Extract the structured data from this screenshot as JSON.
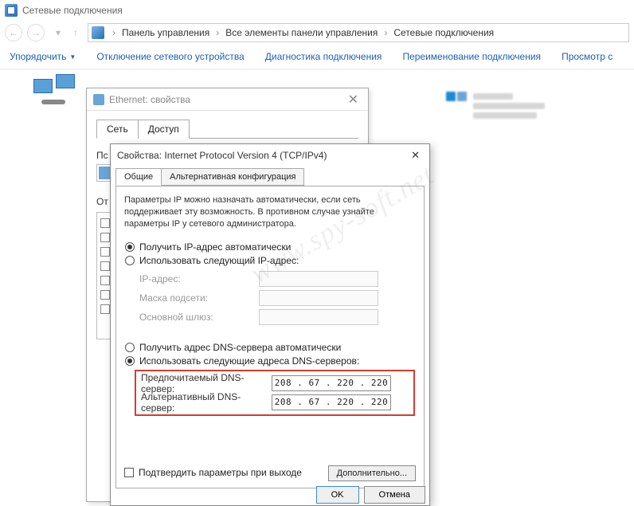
{
  "window": {
    "title": "Сетевые подключения"
  },
  "breadcrumb": {
    "items": [
      "Панель управления",
      "Все элементы панели управления",
      "Сетевые подключения"
    ]
  },
  "toolbar": {
    "organize": "Упорядочить",
    "disable": "Отключение сетевого устройства",
    "diagnose": "Диагностика подключения",
    "rename": "Переименование подключения",
    "view": "Просмотр с"
  },
  "eth_window": {
    "title": "Ethernet: свойства",
    "tabs": {
      "net": "Сеть",
      "access": "Доступ"
    },
    "connect_using_label_short": "Пс",
    "components_label_short": "От"
  },
  "ip_window": {
    "title": "Свойства: Internet Protocol Version 4 (TCP/IPv4)",
    "tabs": {
      "general": "Общие",
      "alt": "Альтернативная конфигурация"
    },
    "intro": "Параметры IP можно назначать автоматически, если сеть поддерживает эту возможность. В противном случае узнайте параметры IP у сетевого администратора.",
    "radio_ip_auto": "Получить IP-адрес автоматически",
    "radio_ip_manual": "Использовать следующий IP-адрес:",
    "ip_labels": {
      "ip": "IP-адрес:",
      "mask": "Маска подсети:",
      "gw": "Основной шлюз:"
    },
    "radio_dns_auto": "Получить адрес DNS-сервера автоматически",
    "radio_dns_manual": "Использовать следующие адреса DNS-серверов:",
    "dns_labels": {
      "pref": "Предпочитаемый DNS-сервер:",
      "alt": "Альтернативный DNS-сервер:"
    },
    "dns_values": {
      "pref": "208 . 67 . 220 . 220",
      "alt": "208 . 67 . 220 . 220"
    },
    "confirm_on_exit": "Подтвердить параметры при выходе",
    "advanced": "Дополнительно...",
    "ok": "OK",
    "cancel": "Отмена"
  },
  "watermark": "www.spy-soft.net"
}
